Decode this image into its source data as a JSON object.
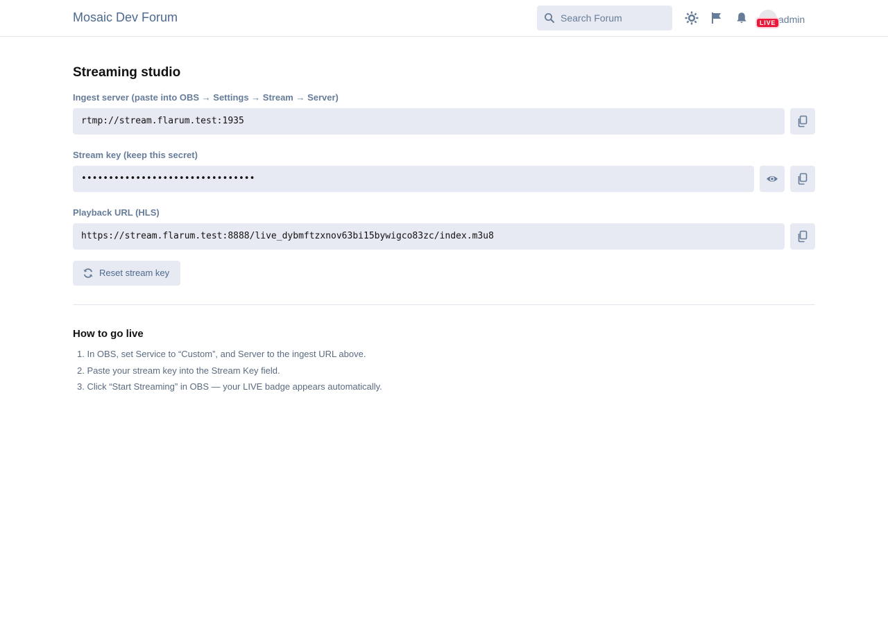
{
  "header": {
    "brand": "Mosaic Dev Forum",
    "search_placeholder": "Search Forum",
    "icons": [
      "theme-toggle-icon",
      "flag-icon",
      "bell-icon"
    ],
    "user": {
      "name": "admin",
      "badge": "LIVE"
    }
  },
  "page": {
    "title": "Streaming studio",
    "ingest": {
      "label": "Ingest server (paste into OBS → Settings → Stream → Server)",
      "value": "rtmp://stream.flarum.test:1935"
    },
    "stream_key": {
      "label": "Stream key (keep this secret)",
      "value": "••••••••••••••••••••••••••••••••"
    },
    "playback": {
      "label": "Playback URL (HLS)",
      "value": "https://stream.flarum.test:8888/live_dybmftzxnov63bi15bywigco83zc/index.m3u8"
    },
    "reset_label": "Reset stream key"
  },
  "howto": {
    "title": "How to go live",
    "steps": [
      "1. In OBS, set Service to “Custom”, and Server to the ingest URL above.",
      "2. Paste your stream key into the Stream Key field.",
      "3. Click “Start Streaming” in OBS — your LIVE badge appears automatically."
    ]
  },
  "colors": {
    "accent": "#4d698e",
    "muted": "#667c99",
    "control_bg": "#e7eaf2",
    "live": "#e8193c"
  }
}
